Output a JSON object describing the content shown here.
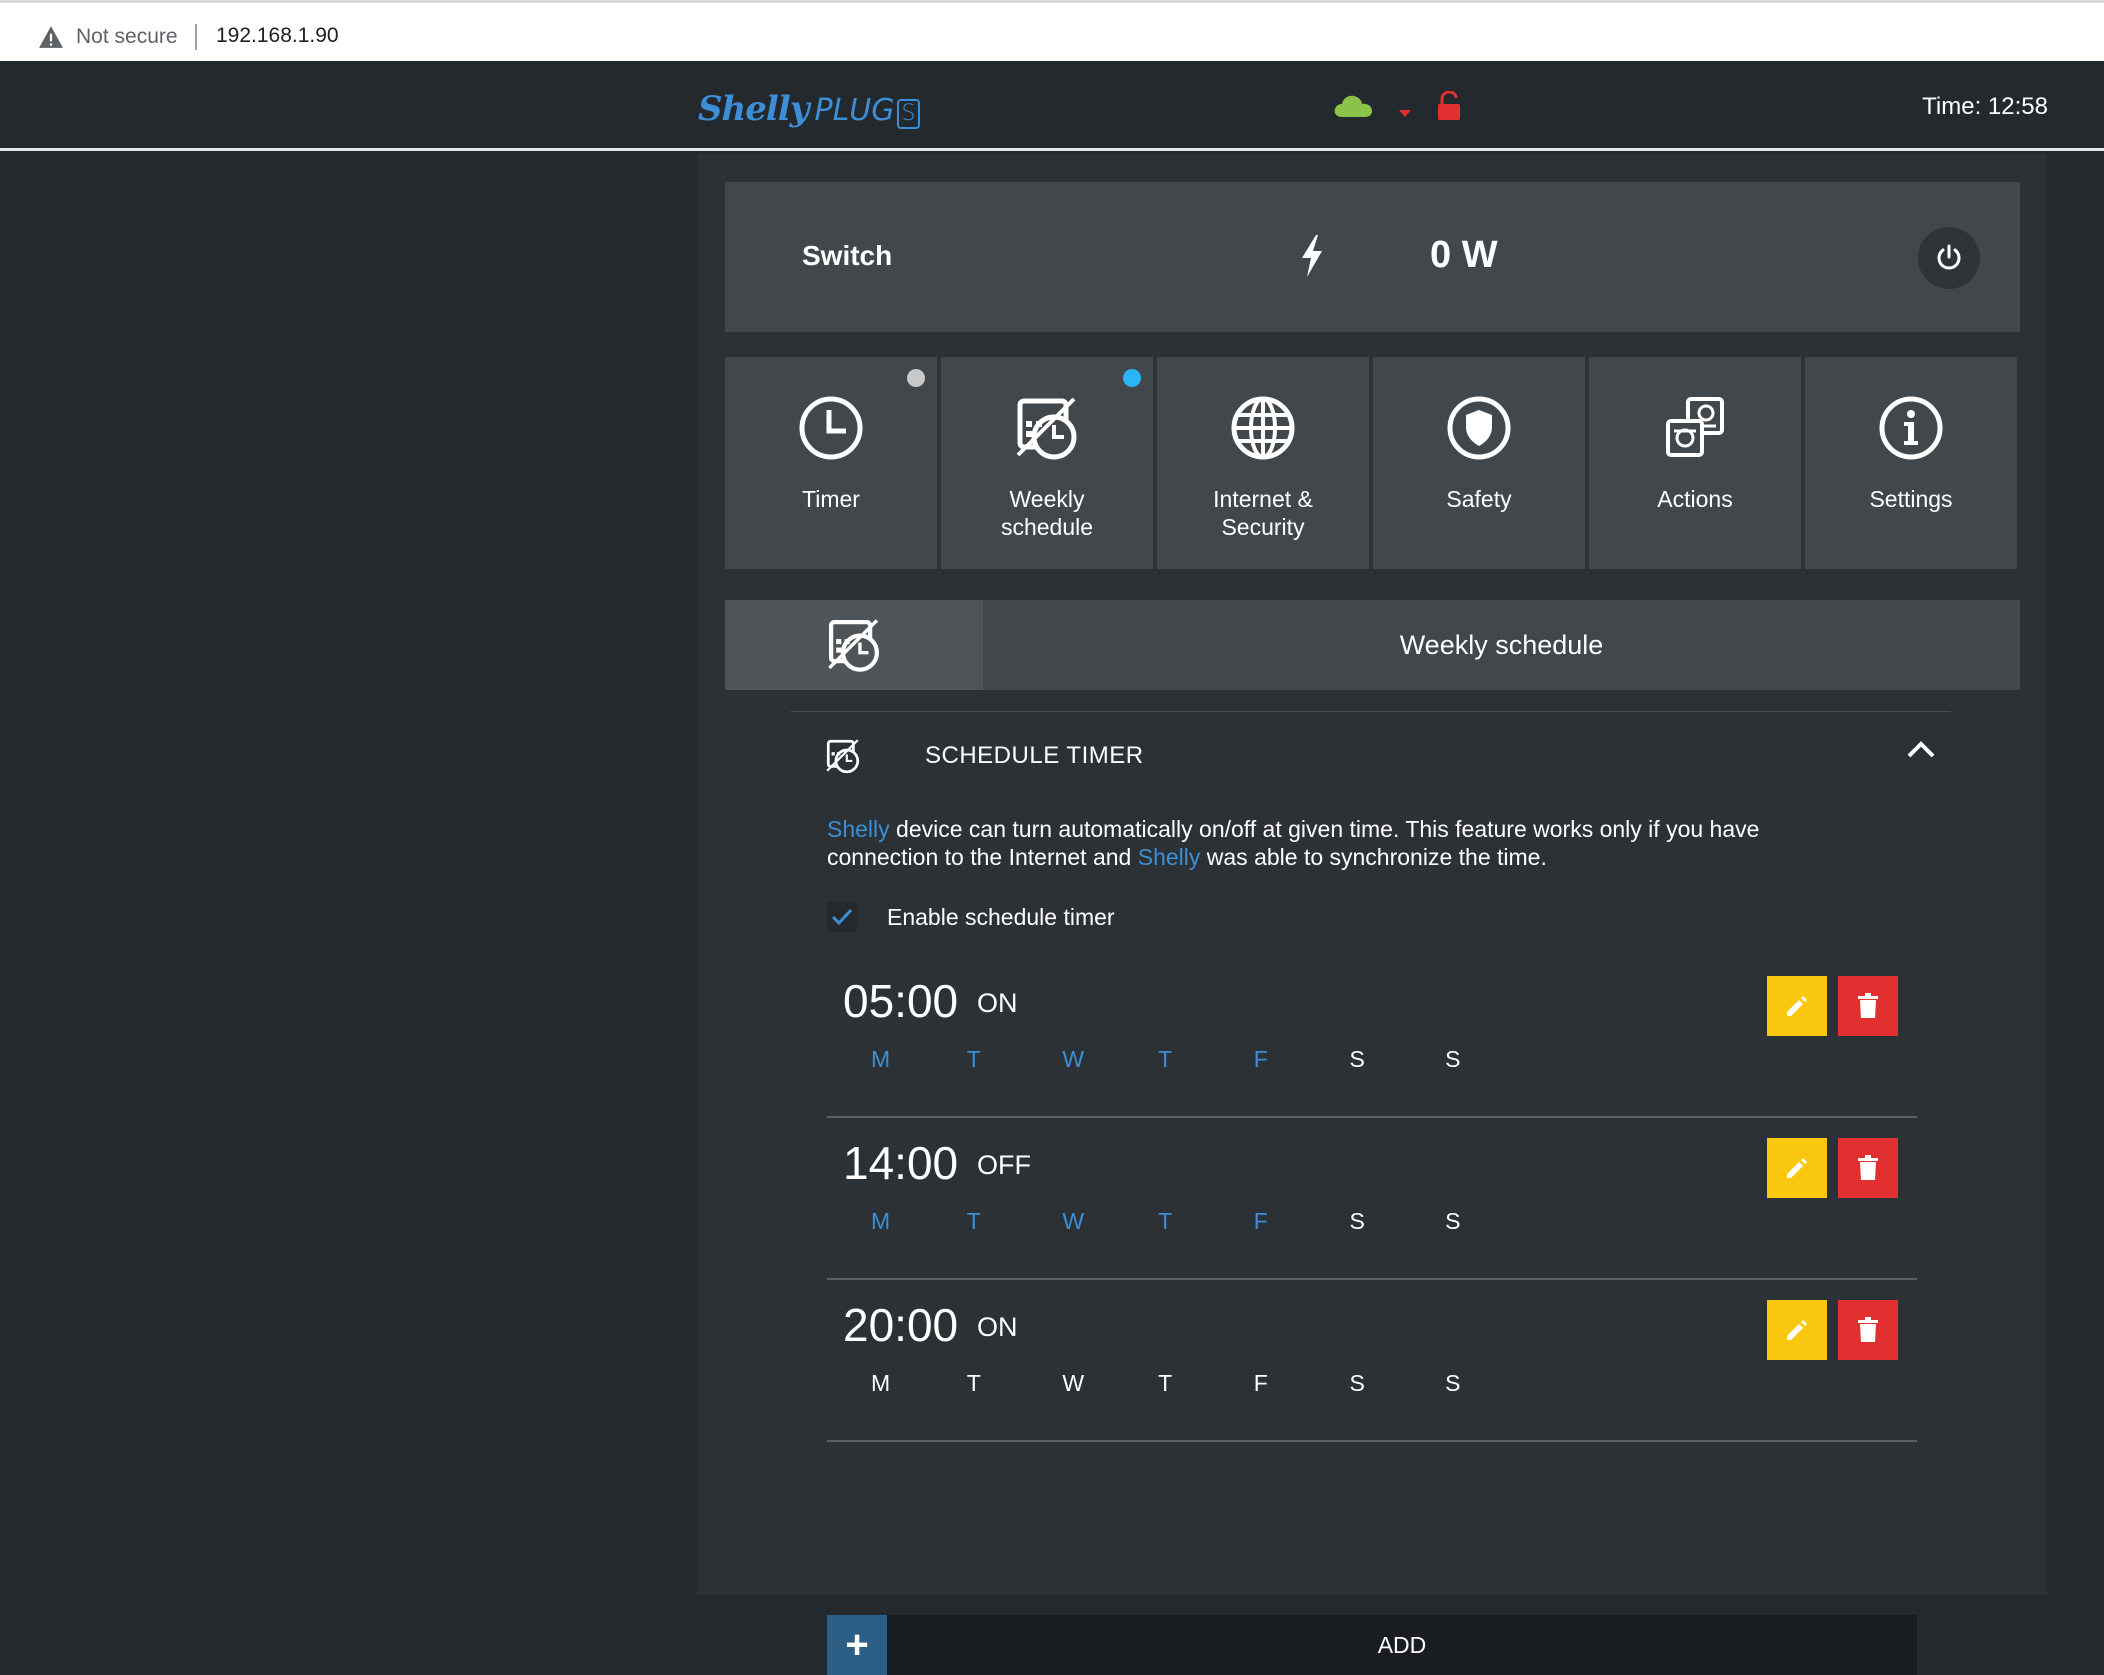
{
  "browser": {
    "security_label": "Not secure",
    "url": "192.168.1.90"
  },
  "header": {
    "logo_brand": "Shelly",
    "logo_product": "PLUG",
    "logo_variant": "S",
    "time_label": "Time: 12:58",
    "status_icons": [
      "cloud-icon",
      "wifi-signal-icon",
      "lock-open-icon"
    ],
    "colors": {
      "cloud": "#8bc34a",
      "signal": "#e1302f",
      "lock": "#e1302f",
      "brand": "#3c8fd6"
    }
  },
  "switch": {
    "label": "Switch",
    "power": "0 W"
  },
  "menu": {
    "items": [
      {
        "label": "Timer",
        "icon": "clock-icon",
        "indicator": "grey"
      },
      {
        "label": "Weekly\nschedule",
        "icon": "weekly-schedule-icon",
        "indicator": "blue"
      },
      {
        "label": "Internet &\nSecurity",
        "icon": "globe-icon",
        "indicator": "none"
      },
      {
        "label": "Safety",
        "icon": "shield-icon",
        "indicator": "none"
      },
      {
        "label": "Actions",
        "icon": "actions-icon",
        "indicator": "none"
      },
      {
        "label": "Settings",
        "icon": "info-icon",
        "indicator": "none"
      }
    ]
  },
  "weekly_schedule": {
    "title": "Weekly schedule",
    "section_title": "SCHEDULE TIMER",
    "description_brand": "Shelly",
    "description_part1": " device can turn automatically on/off at given time. This feature works only if you have connection to the Internet and ",
    "description_part2": " was able to synchronize the time.",
    "enable_label": "Enable schedule timer",
    "enable_checked": true,
    "entries": [
      {
        "time": "05:00",
        "state": "ON",
        "days": [
          "M",
          "T",
          "W",
          "T",
          "F",
          "S",
          "S"
        ],
        "active": [
          true,
          true,
          true,
          true,
          true,
          false,
          false
        ]
      },
      {
        "time": "14:00",
        "state": "OFF",
        "days": [
          "M",
          "T",
          "W",
          "T",
          "F",
          "S",
          "S"
        ],
        "active": [
          true,
          true,
          true,
          true,
          true,
          false,
          false
        ]
      },
      {
        "time": "20:00",
        "state": "ON",
        "days": [
          "M",
          "T",
          "W",
          "T",
          "F",
          "S",
          "S"
        ],
        "active": [
          false,
          false,
          false,
          false,
          false,
          false,
          false
        ]
      }
    ],
    "add_label": "ADD",
    "add_symbol": "+",
    "colors": {
      "edit": "#f9c80e",
      "delete": "#e1302f",
      "active_day": "#3c8fd6"
    }
  }
}
